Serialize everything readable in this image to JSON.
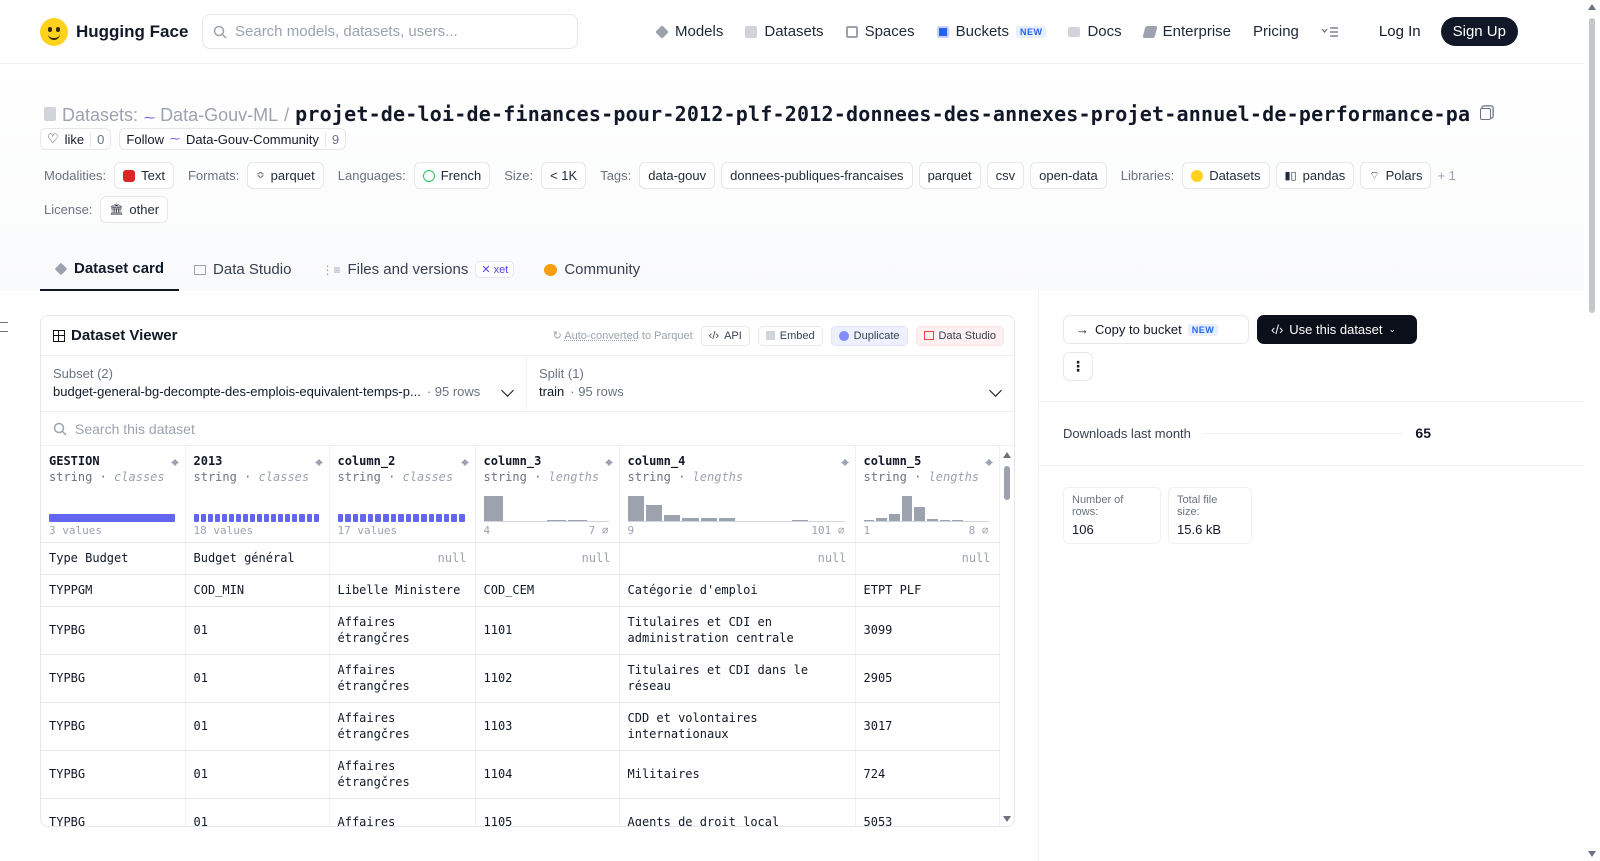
{
  "nav": {
    "brand": "Hugging Face",
    "search_placeholder": "Search models, datasets, users...",
    "links": {
      "models": "Models",
      "datasets": "Datasets",
      "spaces": "Spaces",
      "buckets": "Buckets",
      "buckets_badge": "NEW",
      "docs": "Docs",
      "enterprise": "Enterprise",
      "pricing": "Pricing"
    },
    "login": "Log In",
    "signup": "Sign Up"
  },
  "header": {
    "prefix": "Datasets:",
    "org": "Data-Gouv-ML",
    "sep": "/",
    "name": "projet-de-loi-de-finances-pour-2012-plf-2012-donnees-des-annexes-projet-annuel-de-performance-pa",
    "like_label": "like",
    "like_count": "0",
    "follow_label": "Follow",
    "follow_org": "Data-Gouv-Community",
    "follow_count": "9"
  },
  "meta": {
    "modalities_label": "Modalities:",
    "modalities": "Text",
    "formats_label": "Formats:",
    "formats": "parquet",
    "languages_label": "Languages:",
    "languages": "French",
    "size_label": "Size:",
    "size": "< 1K",
    "tags_label": "Tags:",
    "tags": [
      "data-gouv",
      "donnees-publiques-francaises",
      "parquet",
      "csv",
      "open-data"
    ],
    "libraries_label": "Libraries:",
    "libraries": [
      "Datasets",
      "pandas",
      "Polars"
    ],
    "libraries_more": "+ 1",
    "license_label": "License:",
    "license": "other"
  },
  "tabs": {
    "card": "Dataset card",
    "studio": "Data Studio",
    "files": "Files and versions",
    "xet": "xet",
    "community": "Community"
  },
  "viewer": {
    "title": "Dataset Viewer",
    "auto_underlined": "Auto-converted",
    "auto_rest": " to Parquet",
    "api": "API",
    "embed": "Embed",
    "duplicate": "Duplicate",
    "data_studio": "Data Studio",
    "subset_label": "Subset (2)",
    "subset_value": "budget-general-bg-decompte-des-emplois-equivalent-temps-p...",
    "subset_rows": "· 95 rows",
    "split_label": "Split (1)",
    "split_value": "train",
    "split_rows": "· 95 rows",
    "search_placeholder": "Search this dataset",
    "columns": [
      {
        "name": "GESTION",
        "type": "string",
        "kind": "classes",
        "footer_left": "3 values",
        "footer_right": "",
        "segments": 1
      },
      {
        "name": "2013",
        "type": "string",
        "kind": "classes",
        "footer_left": "18 values",
        "footer_right": "",
        "segments": 18
      },
      {
        "name": "column_2",
        "type": "string",
        "kind": "classes",
        "footer_left": "17 values",
        "footer_right": "",
        "segments": 17
      },
      {
        "name": "column_3",
        "type": "string",
        "kind": "lengths",
        "footer_left": "4",
        "footer_right": "7 ⌀",
        "hist": [
          85,
          0,
          0,
          5,
          5,
          0
        ]
      },
      {
        "name": "column_4",
        "type": "string",
        "kind": "lengths",
        "footer_left": "9",
        "footer_right": "101 ⌀",
        "hist": [
          85,
          55,
          20,
          10,
          10,
          10,
          0,
          0,
          0,
          5,
          0,
          0
        ]
      },
      {
        "name": "column_5",
        "type": "string",
        "kind": "lengths",
        "footer_left": "1",
        "footer_right": "8 ⌀",
        "hist": [
          5,
          12,
          25,
          85,
          50,
          8,
          5,
          5,
          0,
          0
        ]
      }
    ],
    "rows": [
      [
        "Type Budget",
        "Budget général",
        "null",
        "null",
        "null",
        "null"
      ],
      [
        "TYPPGM",
        "COD_MIN",
        "Libelle Ministere",
        "COD_CEM",
        "Catégorie d'emploi",
        "ETPT PLF"
      ],
      [
        "TYPBG",
        "01",
        "Affaires étrangčres",
        "1101",
        "Titulaires et CDI en administration centrale",
        "3099"
      ],
      [
        "TYPBG",
        "01",
        "Affaires étrangčres",
        "1102",
        "Titulaires et CDI dans le réseau",
        "2905"
      ],
      [
        "TYPBG",
        "01",
        "Affaires étrangčres",
        "1103",
        "CDD et volontaires internationaux",
        "3017"
      ],
      [
        "TYPBG",
        "01",
        "Affaires étrangčres",
        "1104",
        "Militaires",
        "724"
      ],
      [
        "TYPBG",
        "01",
        "Affaires",
        "1105",
        "Agents de droit local",
        "5053"
      ]
    ]
  },
  "sidebar": {
    "copy_bucket": "Copy to bucket",
    "copy_badge": "NEW",
    "use_dataset": "Use this dataset",
    "downloads_label": "Downloads last month",
    "downloads": "65",
    "rows_label": "Number of rows:",
    "rows_value": "106",
    "size_label": "Total file size:",
    "size_value": "15.6 kB"
  },
  "colors": {
    "accent": "#6366f1",
    "dark": "#111827",
    "hf_yellow": "#ffd21e"
  }
}
